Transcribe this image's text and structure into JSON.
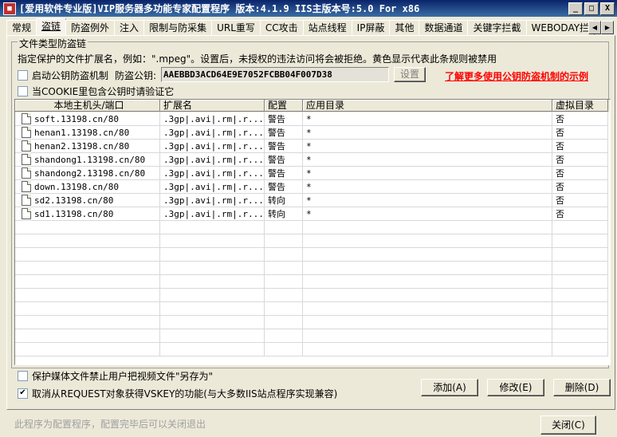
{
  "window": {
    "title": "[爱用软件专业版]VIP服务器多功能专家配置程序 版本:4.1.9 IIS主版本号:5.0 For x86",
    "minimize": "_",
    "maximize": "□",
    "close": "X"
  },
  "tabs": [
    "常规",
    "盗链",
    "防盗例外",
    "注入",
    "限制与防采集",
    "URL重写",
    "CC攻击",
    "站点线程",
    "IP屏蔽",
    "其他",
    "数据通道",
    "关键字拦截",
    "WEBODAY拦"
  ],
  "group": {
    "legend": "文件类型防盗链",
    "description": "指定保护的文件扩展名，例如：\".mpeg\"。设置后，未授权的违法访问将会被拒绝。黄色显示代表此条规则被禁用",
    "enable_key_label": "启动公钥防盗机制",
    "key_label": "防盗公钥:",
    "key_value": "AAEBBD3ACD64E9E7052FCBB04F007D38",
    "set_button": "设置",
    "learn_more_link": "了解更多使用公钥防盗机制的示例",
    "cookie_label": "当COOKIE里包含公钥时请验证它"
  },
  "table": {
    "columns": [
      "本地主机头/端口",
      "扩展名",
      "配置",
      "应用目录",
      "虚拟目录"
    ],
    "rows": [
      [
        "soft.13198.cn/80",
        ".3gp|.avi|.rm|.r...",
        "警告",
        "*",
        "否"
      ],
      [
        "henan1.13198.cn/80",
        ".3gp|.avi|.rm|.r...",
        "警告",
        "*",
        "否"
      ],
      [
        "henan2.13198.cn/80",
        ".3gp|.avi|.rm|.r...",
        "警告",
        "*",
        "否"
      ],
      [
        "shandong1.13198.cn/80",
        ".3gp|.avi|.rm|.r...",
        "警告",
        "*",
        "否"
      ],
      [
        "shandong2.13198.cn/80",
        ".3gp|.avi|.rm|.r...",
        "警告",
        "*",
        "否"
      ],
      [
        "down.13198.cn/80",
        ".3gp|.avi|.rm|.r...",
        "警告",
        "*",
        "否"
      ],
      [
        "sd2.13198.cn/80",
        ".3gp|.avi|.rm|.r...",
        "转向",
        "*",
        "否"
      ],
      [
        "sd1.13198.cn/80",
        ".3gp|.avi|.rm|.r...",
        "转向",
        "*",
        "否"
      ]
    ]
  },
  "options": {
    "protect_saveas": "保护媒体文件禁止用户把视频文件\"另存为\"",
    "cancel_vskey": "取消从REQUEST对象获得VSKEY的功能(与大多数IIS站点程序实现兼容)",
    "cancel_vskey_checked": true
  },
  "buttons": {
    "add": "添加(A)",
    "edit": "修改(E)",
    "delete": "删除(D)",
    "close": "关闭(C)"
  },
  "footnote": "此程序为配置程序，配置完毕后可以关闭退出"
}
